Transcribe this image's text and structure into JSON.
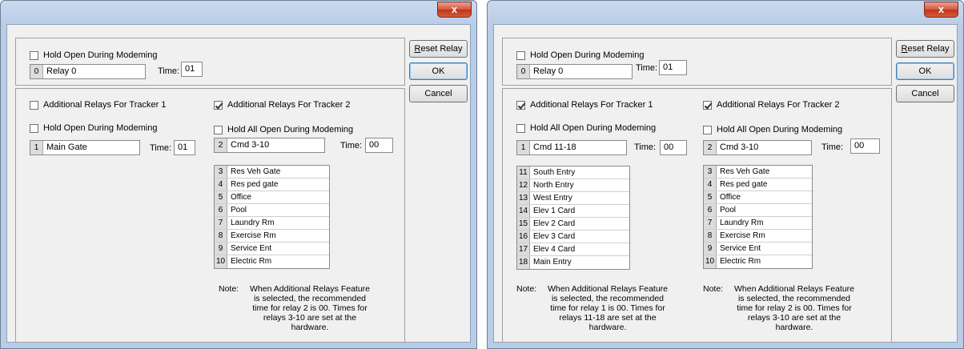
{
  "close_glyph": "x",
  "buttons": {
    "reset_underline": "R",
    "reset_rest": "eset Relay",
    "ok": "OK",
    "cancel": "Cancel"
  },
  "labels": {
    "time": "Time:",
    "note_label": "Note:"
  },
  "windows": [
    {
      "top": {
        "hold_open_label": "Hold Open During Modeming",
        "hold_open_checked": false,
        "relay_num": "0",
        "relay_name": "Relay 0",
        "time": "01"
      },
      "tracker1": {
        "label": "Additional Relays For Tracker 1",
        "checked": false,
        "hold_label": "Hold Open During Modeming",
        "hold_checked": false,
        "relay_num": "1",
        "relay_name": "Main Gate",
        "time": "01",
        "list": [],
        "note": ""
      },
      "tracker2": {
        "label": "Additional Relays For Tracker 2",
        "checked": true,
        "hold_label": "Hold All Open During Modeming",
        "hold_checked": false,
        "relay_num": "2",
        "relay_name": "Cmd 3-10",
        "time": "00",
        "list": [
          {
            "num": "3",
            "name": "Res Veh Gate"
          },
          {
            "num": "4",
            "name": "Res ped gate"
          },
          {
            "num": "5",
            "name": "Office"
          },
          {
            "num": "6",
            "name": "Pool"
          },
          {
            "num": "7",
            "name": "Laundry Rm"
          },
          {
            "num": "8",
            "name": "Exercise Rm"
          },
          {
            "num": "9",
            "name": "Service Ent"
          },
          {
            "num": "10",
            "name": "Electric Rm"
          }
        ],
        "note": "When Additional Relays Feature is selected, the recommended time for relay 2 is 00. Times for relays 3-10 are set at the hardware."
      }
    },
    {
      "top": {
        "hold_open_label": "Hold Open During Modeming",
        "hold_open_checked": false,
        "relay_num": "0",
        "relay_name": "Relay 0",
        "time": "01"
      },
      "tracker1": {
        "label": "Additional Relays For Tracker 1",
        "checked": true,
        "hold_label": "Hold All Open During Modeming",
        "hold_checked": false,
        "relay_num": "1",
        "relay_name": "Cmd 11-18",
        "time": "00",
        "list": [
          {
            "num": "11",
            "name": "South Entry"
          },
          {
            "num": "12",
            "name": "North Entry"
          },
          {
            "num": "13",
            "name": "West Entry"
          },
          {
            "num": "14",
            "name": "Elev 1 Card"
          },
          {
            "num": "15",
            "name": "Elev 2 Card"
          },
          {
            "num": "16",
            "name": "Elev 3 Card"
          },
          {
            "num": "17",
            "name": "Elev 4 Card"
          },
          {
            "num": "18",
            "name": "Main Entry"
          }
        ],
        "note": "When Additional Relays Feature is selected, the recommended time for relay 1 is 00. Times for relays 11-18 are set at the hardware."
      },
      "tracker2": {
        "label": "Additional Relays For Tracker 2",
        "checked": true,
        "hold_label": "Hold All Open During Modeming",
        "hold_checked": false,
        "relay_num": "2",
        "relay_name": "Cmd 3-10",
        "time": "00",
        "list": [
          {
            "num": "3",
            "name": "Res Veh Gate"
          },
          {
            "num": "4",
            "name": "Res ped gate"
          },
          {
            "num": "5",
            "name": "Office"
          },
          {
            "num": "6",
            "name": "Pool"
          },
          {
            "num": "7",
            "name": "Laundry Rm"
          },
          {
            "num": "8",
            "name": "Exercise Rm"
          },
          {
            "num": "9",
            "name": "Service Ent"
          },
          {
            "num": "10",
            "name": "Electric Rm"
          }
        ],
        "note": "When Additional Relays Feature is selected, the recommended time for relay 2 is 00. Times for relays 3-10 are set at the hardware."
      }
    }
  ]
}
